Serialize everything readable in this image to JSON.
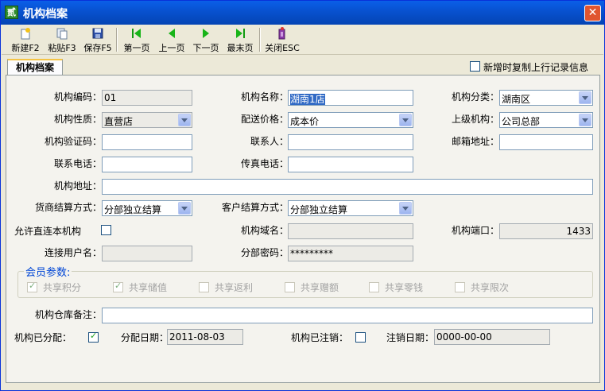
{
  "window": {
    "title": "机构档案",
    "app_icon": "app-logo-icon",
    "close_icon": "close-icon"
  },
  "toolbar": {
    "items": [
      {
        "label": "新建F2",
        "icon": "new-doc-icon"
      },
      {
        "label": "粘贴F3",
        "icon": "paste-icon"
      },
      {
        "label": "保存F5",
        "icon": "save-icon"
      },
      {
        "label": "第一页",
        "icon": "first-page-icon"
      },
      {
        "label": "上一页",
        "icon": "prev-page-icon"
      },
      {
        "label": "下一页",
        "icon": "next-page-icon"
      },
      {
        "label": "最末页",
        "icon": "last-page-icon"
      },
      {
        "label": "关闭ESC",
        "icon": "close-door-icon"
      }
    ]
  },
  "tab": {
    "label": "机构档案"
  },
  "copy_prev": {
    "label": "新增时复制上行记录信息",
    "checked": false
  },
  "form": {
    "org_code": {
      "label": "机构编码：",
      "value": "01"
    },
    "org_name": {
      "label": "机构名称：",
      "value": "湖南1店"
    },
    "org_class": {
      "label": "机构分类：",
      "value": "湖南区"
    },
    "org_nature": {
      "label": "机构性质：",
      "value": "直营店"
    },
    "delivery_price": {
      "label": "配送价格：",
      "value": "成本价"
    },
    "parent_org": {
      "label": "上级机构：",
      "value": "公司总部"
    },
    "verify_code": {
      "label": "机构验证码：",
      "value": ""
    },
    "contact": {
      "label": "联系人：",
      "value": ""
    },
    "email": {
      "label": "邮箱地址：",
      "value": ""
    },
    "phone": {
      "label": "联系电话：",
      "value": ""
    },
    "fax": {
      "label": "传真电话：",
      "value": ""
    },
    "address": {
      "label": "机构地址：",
      "value": ""
    },
    "supplier_settle": {
      "label": "货商结算方式：",
      "value": "分部独立结算"
    },
    "customer_settle": {
      "label": "客户结算方式：",
      "value": "分部独立结算"
    },
    "allow_direct": {
      "label": "允许直连本机构",
      "checked": false
    },
    "domain": {
      "label": "机构域名：",
      "value": ""
    },
    "port": {
      "label": "机构端口：",
      "value": "1433"
    },
    "conn_user": {
      "label": "连接用户名：",
      "value": ""
    },
    "branch_pwd": {
      "label": "分部密码：",
      "value": "*********"
    },
    "warehouse_note": {
      "label": "机构仓库备注：",
      "value": ""
    },
    "assigned": {
      "label": "机构已分配：",
      "checked": true
    },
    "assign_date": {
      "label": "分配日期：",
      "value": "2011-08-03"
    },
    "cancelled": {
      "label": "机构已注销：",
      "checked": false
    },
    "cancel_date": {
      "label": "注销日期：",
      "value": "0000-00-00"
    }
  },
  "member": {
    "title": "会员参数:",
    "items": [
      {
        "label": "共享积分",
        "checked": true
      },
      {
        "label": "共享储值",
        "checked": true
      },
      {
        "label": "共享返利",
        "checked": false
      },
      {
        "label": "共享赠额",
        "checked": false
      },
      {
        "label": "共享零钱",
        "checked": false
      },
      {
        "label": "共享限次",
        "checked": false
      }
    ]
  }
}
